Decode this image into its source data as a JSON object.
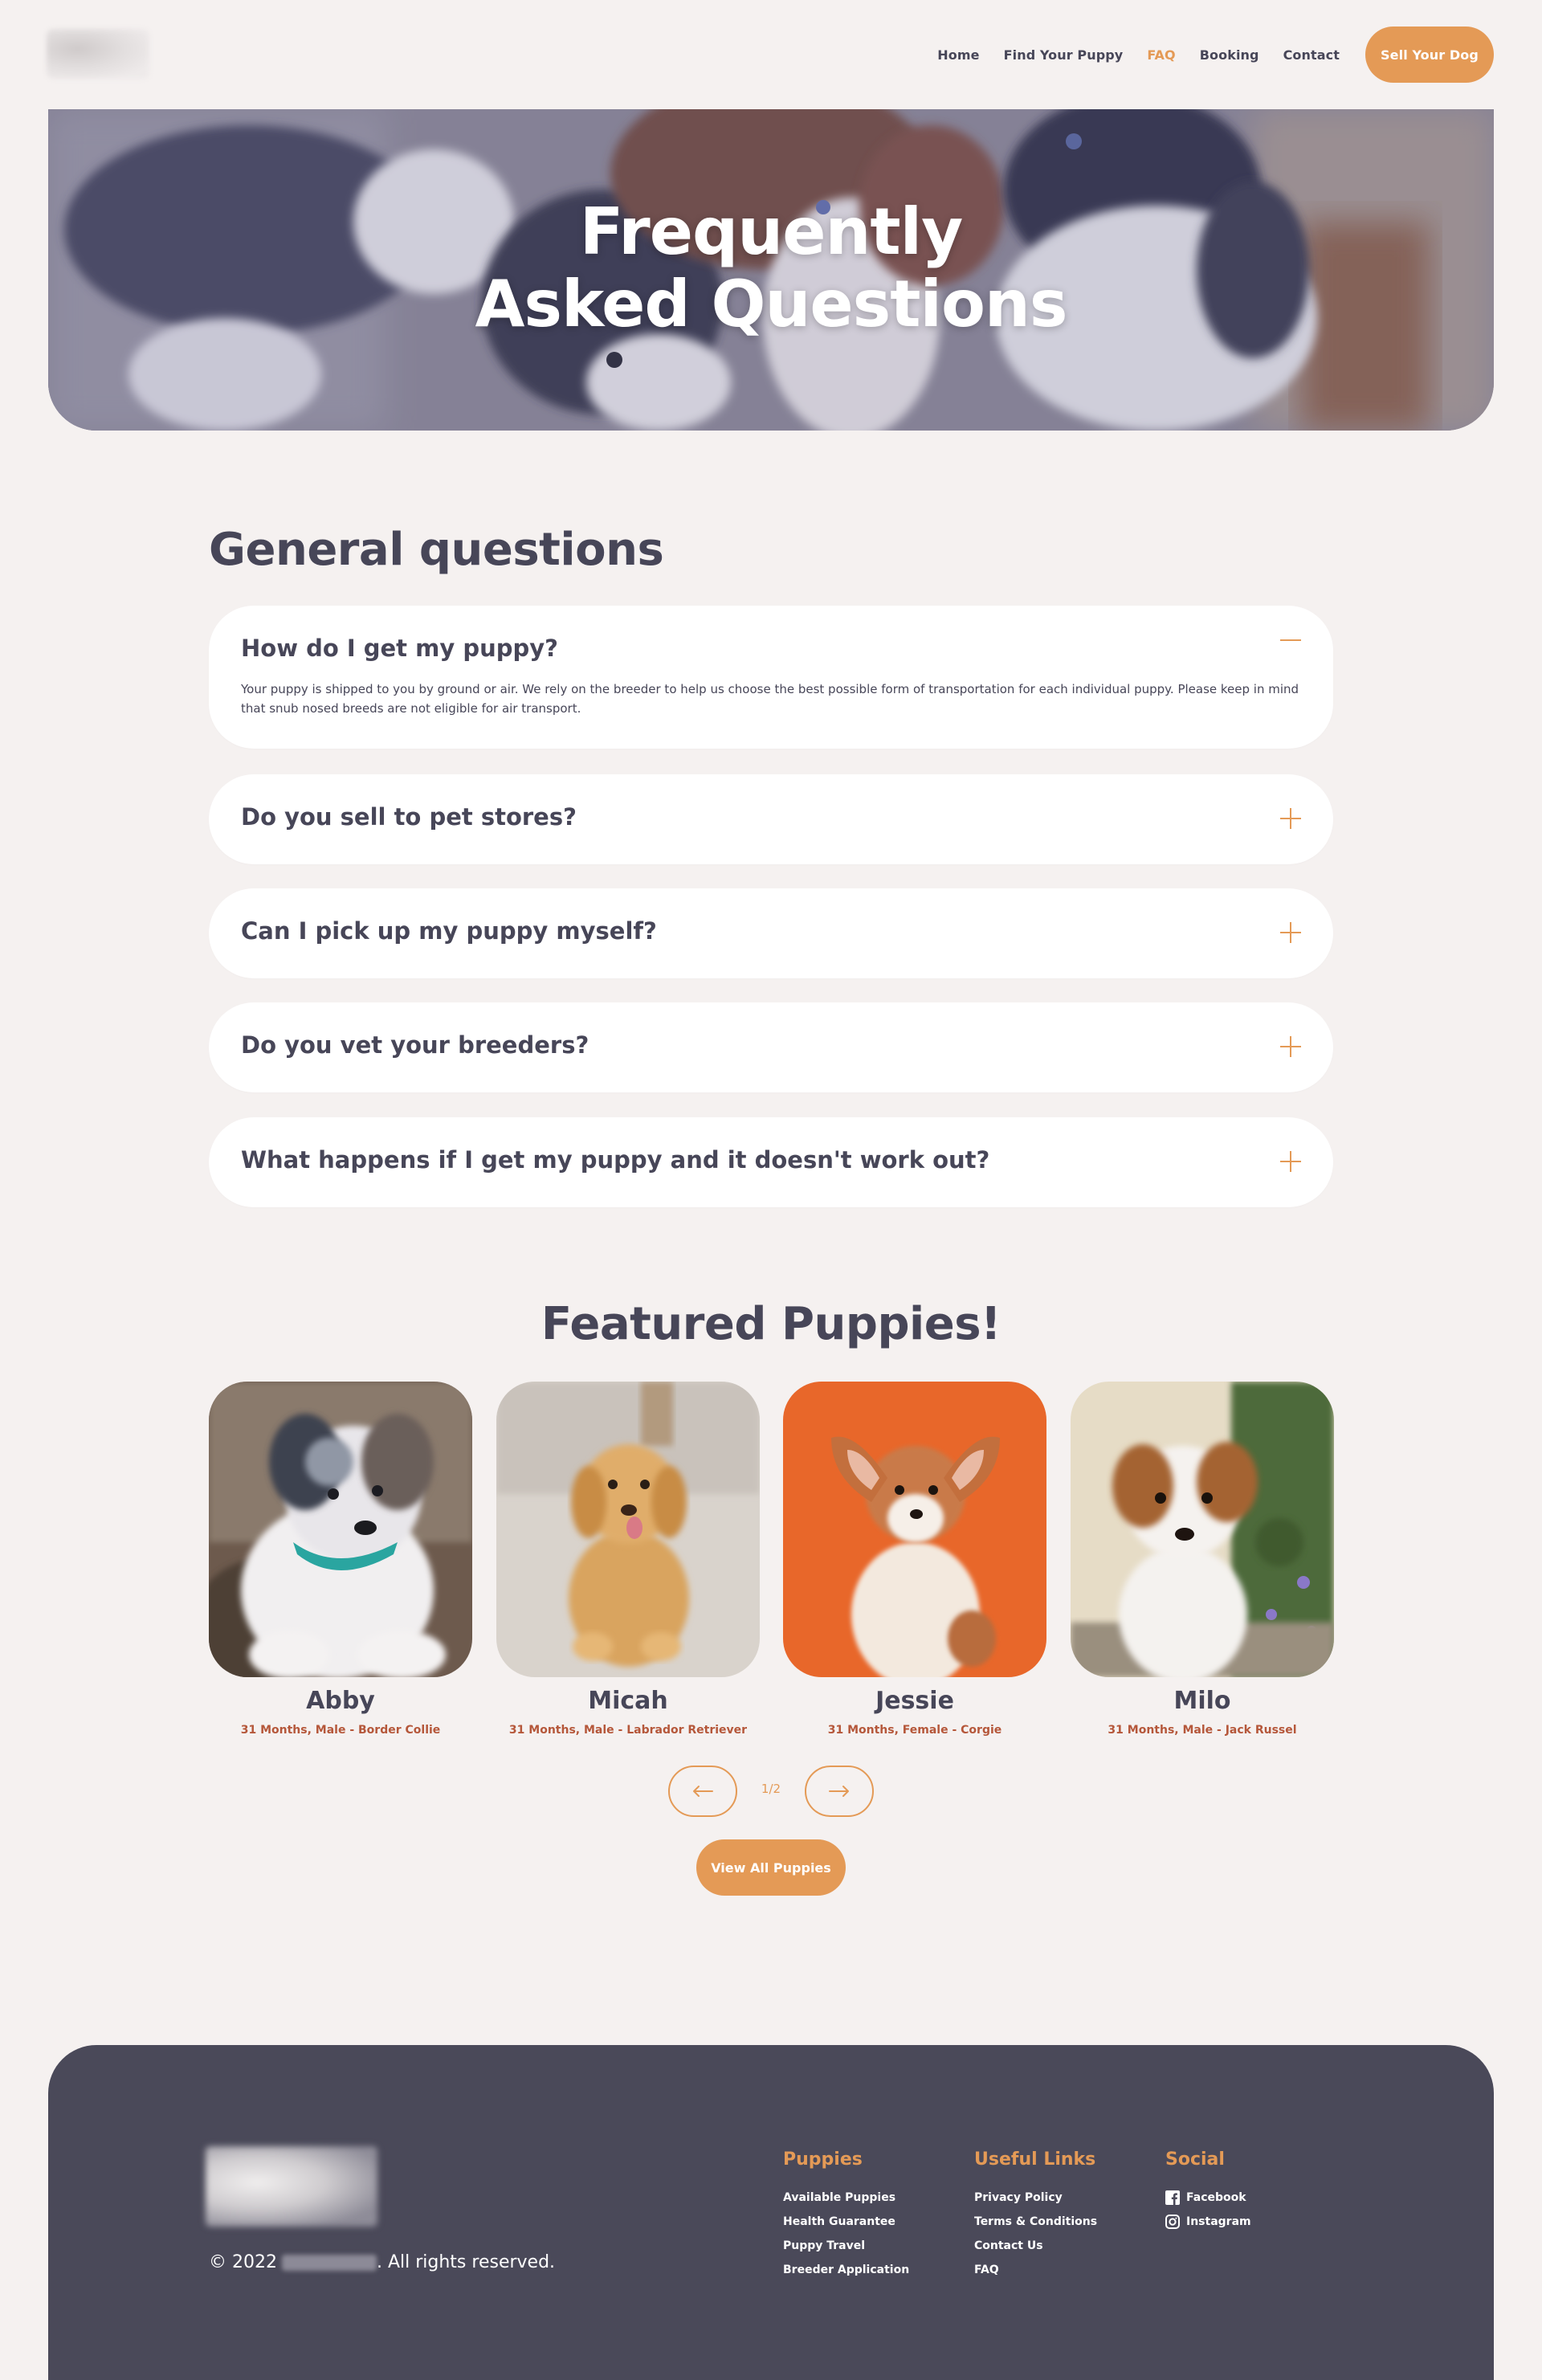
{
  "header": {
    "nav": [
      {
        "label": "Home",
        "active": false
      },
      {
        "label": "Find Your Puppy",
        "active": false
      },
      {
        "label": "FAQ",
        "active": true
      },
      {
        "label": "Booking",
        "active": false
      },
      {
        "label": "Contact",
        "active": false
      }
    ],
    "cta_label": "Sell Your Dog"
  },
  "hero": {
    "title_line1": "Frequently",
    "title_line2": "Asked Questions"
  },
  "faq": {
    "title": "General questions",
    "items": [
      {
        "question": "How do I get my puppy?",
        "expanded": true,
        "answer": "Your puppy is shipped to you by ground or air. We rely on the breeder to help us choose the best possible form of transportation for each individual puppy. Please keep in mind that snub nosed breeds are not eligible for air transport."
      },
      {
        "question": "Do you sell to pet stores?",
        "expanded": false
      },
      {
        "question": "Can I pick up my puppy myself?",
        "expanded": false
      },
      {
        "question": "Do you vet your breeders?",
        "expanded": false
      },
      {
        "question": "What happens if I get my puppy and it doesn't work out?",
        "expanded": false
      }
    ]
  },
  "featured": {
    "title": "Featured Puppies!",
    "puppies": [
      {
        "name": "Abby",
        "details": "31 Months, Male - Border Collie"
      },
      {
        "name": "Micah",
        "details": "31 Months, Male - Labrador Retriever"
      },
      {
        "name": "Jessie",
        "details": "31 Months, Female - Corgie"
      },
      {
        "name": "Milo",
        "details": "31 Months, Male - Jack Russel"
      }
    ],
    "pager": {
      "prev_icon": "arrow-left-icon",
      "next_icon": "arrow-right-icon",
      "current": 1,
      "total": 2,
      "label": "1/2"
    },
    "view_all_label": "View All Puppies"
  },
  "footer": {
    "copyright_prefix": "© 2022",
    "copyright_suffix": ". All rights reserved.",
    "columns": [
      {
        "title": "Puppies",
        "links": [
          "Available Puppies",
          "Health Guarantee",
          "Puppy Travel",
          "Breeder Application"
        ]
      },
      {
        "title": "Useful Links",
        "links": [
          "Privacy Policy",
          "Terms & Conditions",
          "Contact Us",
          "FAQ"
        ]
      },
      {
        "title": "Social",
        "links": [
          "Facebook",
          "Instagram"
        ]
      }
    ]
  },
  "colors": {
    "accent": "#e49a56",
    "text": "#474658",
    "background": "#f5f1f0",
    "footer": "#4a4959",
    "meta": "#b5573a"
  }
}
